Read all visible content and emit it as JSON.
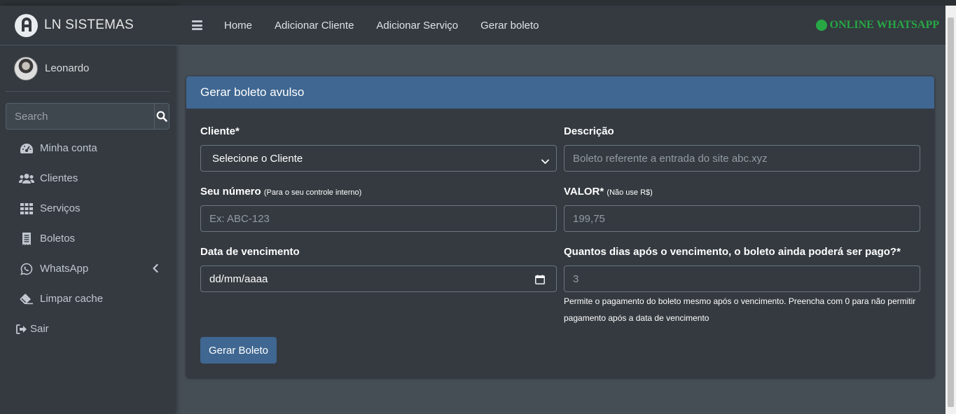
{
  "brand": {
    "title": "LN SISTEMAS",
    "logo_icon": "ln-logo-icon"
  },
  "user": {
    "name": "Leonardo"
  },
  "search": {
    "placeholder": "Search"
  },
  "sidebar": {
    "items": [
      {
        "label": "Minha conta",
        "icon": "dashboard-gauge-icon"
      },
      {
        "label": "Clientes",
        "icon": "users-icon"
      },
      {
        "label": "Serviços",
        "icon": "grid-icon"
      },
      {
        "label": "Boletos",
        "icon": "receipt-icon"
      },
      {
        "label": "WhatsApp",
        "icon": "whatsapp-icon"
      },
      {
        "label": "Limpar cache",
        "icon": "eraser-icon"
      },
      {
        "label": "Sair",
        "icon": "sign-out-icon"
      }
    ]
  },
  "navbar": {
    "links": [
      "Home",
      "Adicionar Cliente",
      "Adicionar Serviço",
      "Gerar boleto"
    ],
    "status": "ONLINE WHATSAPP",
    "status_color": "#28a745"
  },
  "card": {
    "title": "Gerar boleto avulso",
    "header_color": "#3f6791",
    "cliente": {
      "label": "Cliente*",
      "selected": "Selecione o Cliente"
    },
    "descricao": {
      "label": "Descrição",
      "placeholder": "Boleto referente a entrada do site abc.xyz"
    },
    "numero": {
      "label": "Seu número",
      "hint": "(Para o seu controle interno)",
      "placeholder": "Ex: ABC-123"
    },
    "valor": {
      "label": "VALOR*",
      "hint": "(Não use R$)",
      "placeholder": "199,75"
    },
    "vencimento": {
      "label": "Data de vencimento",
      "value": "dd/mm/aaaa"
    },
    "dias": {
      "label": "Quantos dias após o vencimento, o boleto ainda poderá ser pago?*",
      "placeholder": "3",
      "help_line1": "Permite o pagamento do boleto mesmo após o vencimento. Preencha com 0 para não permitir",
      "help_line2": "pagamento após a data de vencimento"
    },
    "submit": "Gerar Boleto"
  }
}
